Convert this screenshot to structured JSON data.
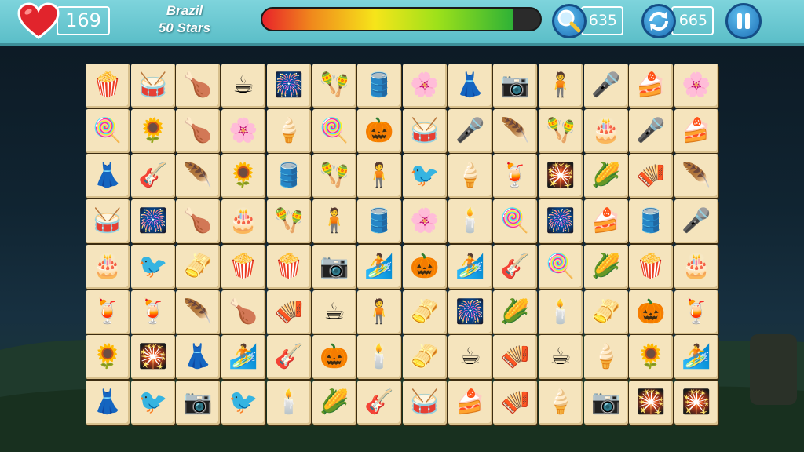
{
  "hud": {
    "lives": "169",
    "level_name": "Brazil",
    "level_stars": "50 Stars",
    "timer_fraction": 0.9,
    "hint_count": "635",
    "shuffle_count": "665"
  },
  "colors": {
    "hud_bg": "#6cc8d2",
    "tile": "#f5e4bd",
    "button_blue": "#2a84cc",
    "heart_red": "#e1242c"
  },
  "board": {
    "columns": 14,
    "rows": 8,
    "tiles": [
      [
        "popcorn",
        "conga-drums",
        "coxinha",
        "coffee-cup",
        "fireworks",
        "maracas",
        "drum",
        "pink-flower",
        "festa-dress",
        "camera",
        "sack-race",
        "microphone",
        "cake-slice",
        "pink-flower"
      ],
      [
        "cotton-candy",
        "sunflower-pot",
        "coxinha",
        "pink-flower",
        "ice-cream",
        "cotton-candy",
        "pumpkin",
        "conga-drums",
        "microphone",
        "carnival-headdress",
        "maracas",
        "birthday-cake",
        "microphone",
        "cake-slice"
      ],
      [
        "festa-dress",
        "guitar",
        "carnival-headdress",
        "sunflower-pot",
        "drum",
        "maracas",
        "sack-race",
        "blue-bird",
        "ice-cream",
        "fruit-punch",
        "fireworks-sparkle",
        "corn-tray",
        "accordion",
        "carnival-headdress"
      ],
      [
        "conga-drums",
        "fireworks",
        "coxinha",
        "birthday-cake",
        "maracas",
        "sack-race",
        "drum",
        "pink-flower",
        "candles",
        "cotton-candy",
        "fireworks",
        "cake-slice",
        "drum",
        "microphone"
      ],
      [
        "birthday-cake",
        "blue-bird",
        "pamonha",
        "popcorn",
        "popcorn",
        "camera",
        "surfboard",
        "pumpkin",
        "surfboard",
        "guitar",
        "cotton-candy",
        "corn-tray",
        "popcorn",
        "birthday-cake"
      ],
      [
        "fruit-punch",
        "fruit-punch",
        "carnival-headdress",
        "coxinha",
        "accordion",
        "coffee-cup",
        "sack-race",
        "pamonha",
        "fireworks",
        "corn-tray",
        "candles",
        "pamonha",
        "pumpkin",
        "fruit-punch"
      ],
      [
        "sunflower-pot",
        "fireworks-sparkle",
        "festa-dress",
        "surfboard",
        "guitar",
        "pumpkin",
        "candles",
        "pamonha",
        "coffee-cup",
        "accordion",
        "coffee-cup",
        "ice-cream",
        "sunflower-pot",
        "surfboard"
      ],
      [
        "festa-dress",
        "blue-bird",
        "camera",
        "blue-bird",
        "candles",
        "corn-tray",
        "guitar",
        "conga-drums",
        "cake-slice",
        "accordion",
        "ice-cream",
        "camera",
        "fireworks-sparkle",
        "fireworks-sparkle"
      ]
    ]
  }
}
